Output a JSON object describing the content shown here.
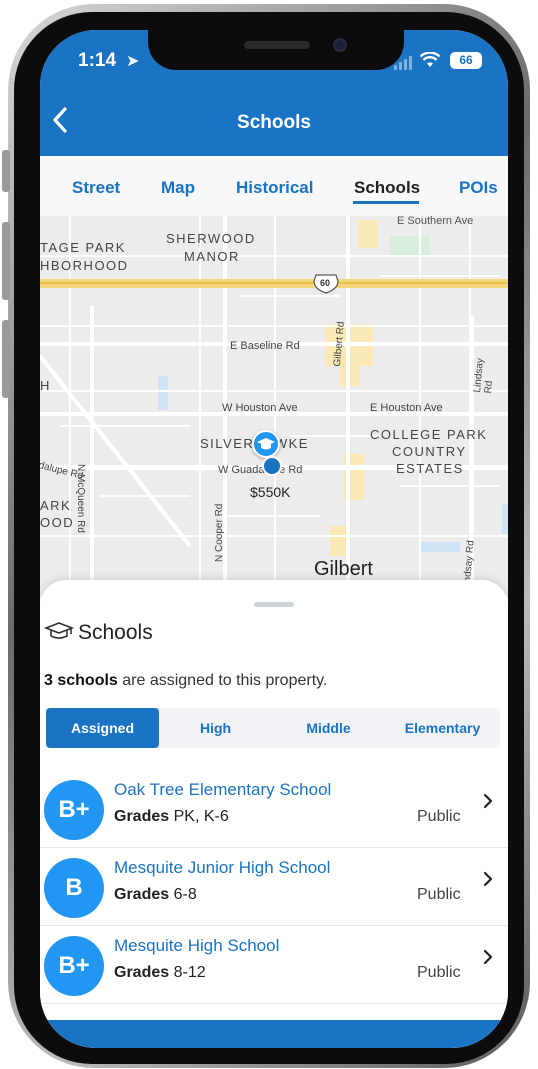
{
  "status": {
    "time": "1:14",
    "battery": "66"
  },
  "header": {
    "title": "Schools"
  },
  "tabs": [
    {
      "label": "Street"
    },
    {
      "label": "Map"
    },
    {
      "label": "Historical"
    },
    {
      "label": "Schools"
    },
    {
      "label": "POIs"
    }
  ],
  "map": {
    "labels": {
      "southern": "E Southern Ave",
      "sherwood1": "SHERWOOD",
      "sherwood2": "MANOR",
      "park1": "TAGE PARK",
      "park2": "HBORHOOD",
      "hwy": "60",
      "baseline": "E Baseline Rd",
      "gilbert_rd": "Gilbert Rd",
      "lindsay_rd": "Lindsay Rd",
      "houston_w": "W Houston Ave",
      "houston_e": "E Houston Ave",
      "college1": "COLLEGE PARK",
      "college2": "COUNTRY",
      "college3": "ESTATES",
      "silverhawke": "SILVERHAWKE",
      "price": "$550K",
      "guadalupe": "W Guadalupe Rd",
      "guadalupe_w": "dalupe Rd",
      "mcqueen": "N McQueen Rd",
      "cooper": "N Cooper Rd",
      "ark": "ARK",
      "ood": "OOD",
      "h": "H",
      "lindsay_rd2": "ndsay Rd",
      "city": "Gilbert"
    }
  },
  "sheet": {
    "title": "Schools",
    "summary_count": "3 schools",
    "summary_rest": " are assigned to this property.",
    "segments": [
      {
        "label": "Assigned"
      },
      {
        "label": "High"
      },
      {
        "label": "Middle"
      },
      {
        "label": "Elementary"
      }
    ],
    "grades_label": "Grades",
    "schools": [
      {
        "rating": "B+",
        "name": "Oak Tree Elementary School",
        "grades": "PK, K-6",
        "type": "Public"
      },
      {
        "rating": "B",
        "name": "Mesquite Junior High School",
        "grades": "6-8",
        "type": "Public"
      },
      {
        "rating": "B+",
        "name": "Mesquite High School",
        "grades": "8-12",
        "type": "Public"
      }
    ]
  },
  "colors": {
    "brand": "#1a73c3",
    "badge": "#2196f3"
  },
  "icons": [
    "back-icon",
    "location-arrow-icon",
    "wifi-icon",
    "graduation-cap-icon",
    "chevron-right-icon"
  ]
}
